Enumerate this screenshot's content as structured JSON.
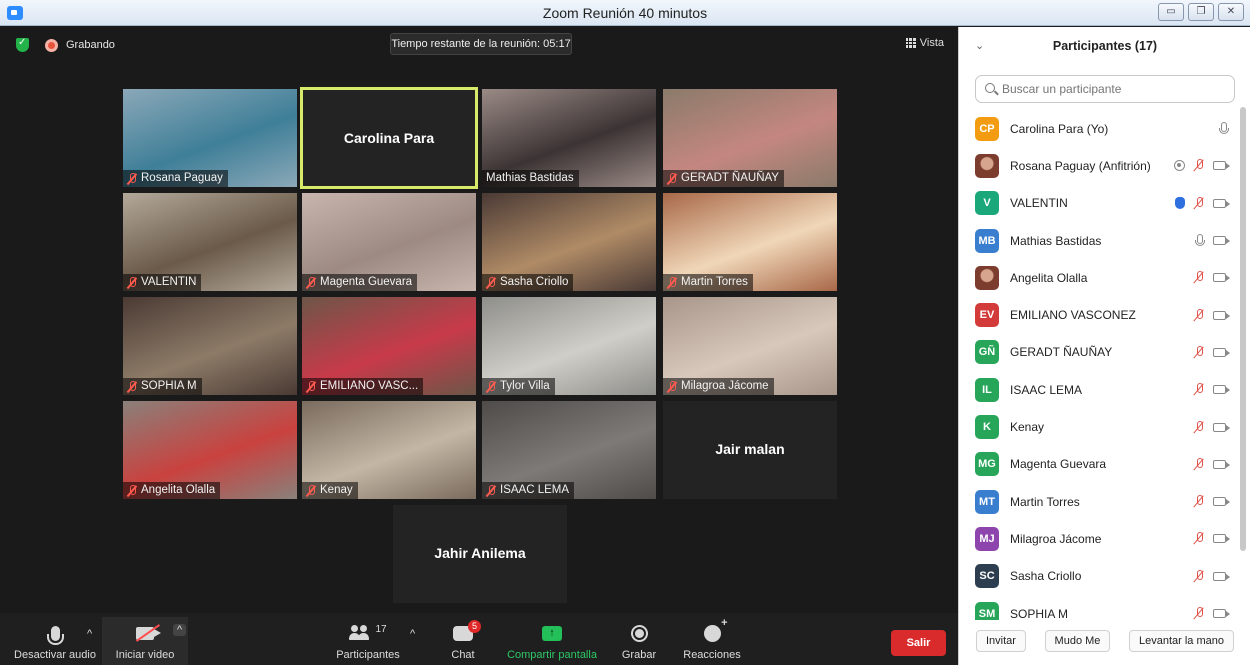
{
  "window": {
    "title": "Zoom Reunión 40 minutos"
  },
  "meeting": {
    "recording_label": "Grabando",
    "time_remaining": "Tiempo restante de la reunión: 05:17",
    "view_label": "Vista",
    "tiles": [
      {
        "name": "Rosana Paguay",
        "muted": true,
        "bg": "#8ba8b8",
        "accent": "#3f7f98"
      },
      {
        "name": "Carolina Para",
        "text_only": true,
        "active": true
      },
      {
        "name": "Mathias Bastidas",
        "muted": false,
        "bg": "#9a8a86",
        "accent": "#3c3434"
      },
      {
        "name": "GERADT  ÑAUÑAY",
        "muted": true,
        "bg": "#8a7a6a",
        "accent": "#c48780"
      },
      {
        "name": "VALENTIN",
        "muted": true,
        "bg": "#b3a99a",
        "accent": "#6b5a49"
      },
      {
        "name": "Magenta Guevara",
        "muted": true,
        "bg": "#c8b6ae",
        "accent": "#9d8a82"
      },
      {
        "name": "Sasha Criollo",
        "muted": true,
        "bg": "#4a3a35",
        "accent": "#b08b66"
      },
      {
        "name": "Martin Torres",
        "muted": true,
        "bg": "#a86848",
        "accent": "#f0d7b8"
      },
      {
        "name": "SOPHIA M",
        "muted": true,
        "bg": "#4a3a33",
        "accent": "#8d7b68"
      },
      {
        "name": "EMILIANO VASC...",
        "muted": true,
        "bg": "#6d5648",
        "accent": "#c83a4a"
      },
      {
        "name": "Tylor Villa",
        "muted": true,
        "bg": "#8e8e8a",
        "accent": "#d0cec8"
      },
      {
        "name": "Milagroa Jácome",
        "muted": true,
        "bg": "#a8968a",
        "accent": "#d8c7bb"
      },
      {
        "name": "Angelita Olalla",
        "muted": true,
        "bg": "#8a807a",
        "accent": "#c9423f"
      },
      {
        "name": "Kenay",
        "muted": true,
        "bg": "#7a6b5e",
        "accent": "#c4b6a4"
      },
      {
        "name": "ISAAC LEMA",
        "muted": true,
        "bg": "#4e4b48",
        "accent": "#7d7a77"
      },
      {
        "name": "Jair malan",
        "text_only": true
      },
      {
        "name": "Jahir Anilema",
        "text_only": true
      }
    ]
  },
  "toolbar": {
    "audio_label": "Desactivar audio",
    "video_label": "Iniciar video",
    "participants_label": "Participantes",
    "participants_count": "17",
    "chat_label": "Chat",
    "chat_badge": "5",
    "share_label": "Compartir pantalla",
    "record_label": "Grabar",
    "reactions_label": "Reacciones",
    "leave_label": "Salir"
  },
  "panel": {
    "title": "Participantes (17)",
    "search_placeholder": "Buscar un participante",
    "participants": [
      {
        "initials": "CP",
        "name": "Carolina Para (Yo)",
        "color": "#f39c12",
        "icons": [
          "mic"
        ]
      },
      {
        "initials": "",
        "name": "Rosana Paguay (Anfitrión)",
        "photo": true,
        "icons": [
          "rec",
          "micoff",
          "cam"
        ]
      },
      {
        "initials": "V",
        "name": "VALENTIN",
        "color": "#1aa87a",
        "icons": [
          "hand",
          "micoff",
          "cam"
        ]
      },
      {
        "initials": "MB",
        "name": "Mathias Bastidas",
        "color": "#3a7ecf",
        "icons": [
          "mic",
          "cam"
        ]
      },
      {
        "initials": "",
        "name": "Angelita Olalla",
        "photo": true,
        "icons": [
          "micoff",
          "cam"
        ]
      },
      {
        "initials": "EV",
        "name": "EMILIANO VASCONEZ",
        "color": "#d33b3b",
        "icons": [
          "micoff",
          "cam"
        ]
      },
      {
        "initials": "GÑ",
        "name": "GERADT  ÑAUÑAY",
        "color": "#27a65a",
        "icons": [
          "micoff",
          "cam"
        ]
      },
      {
        "initials": "IL",
        "name": "ISAAC LEMA",
        "color": "#27a65a",
        "icons": [
          "micoff",
          "cam"
        ]
      },
      {
        "initials": "K",
        "name": "Kenay",
        "color": "#27a65a",
        "icons": [
          "micoff",
          "cam"
        ]
      },
      {
        "initials": "MG",
        "name": "Magenta Guevara",
        "color": "#27a65a",
        "icons": [
          "micoff",
          "cam"
        ]
      },
      {
        "initials": "MT",
        "name": "Martin Torres",
        "color": "#3a7ecf",
        "icons": [
          "micoff",
          "cam"
        ]
      },
      {
        "initials": "MJ",
        "name": "Milagroa Jácome",
        "color": "#8e44ad",
        "icons": [
          "micoff",
          "cam"
        ]
      },
      {
        "initials": "SC",
        "name": "Sasha Criollo",
        "color": "#2c3e50",
        "icons": [
          "micoff",
          "cam"
        ]
      },
      {
        "initials": "SM",
        "name": "SOPHIA M",
        "color": "#27a65a",
        "icons": [
          "micoff",
          "cam"
        ]
      }
    ],
    "invite_label": "Invitar",
    "mute_me_label": "Mudo Me",
    "raise_hand_label": "Levantar la mano"
  }
}
